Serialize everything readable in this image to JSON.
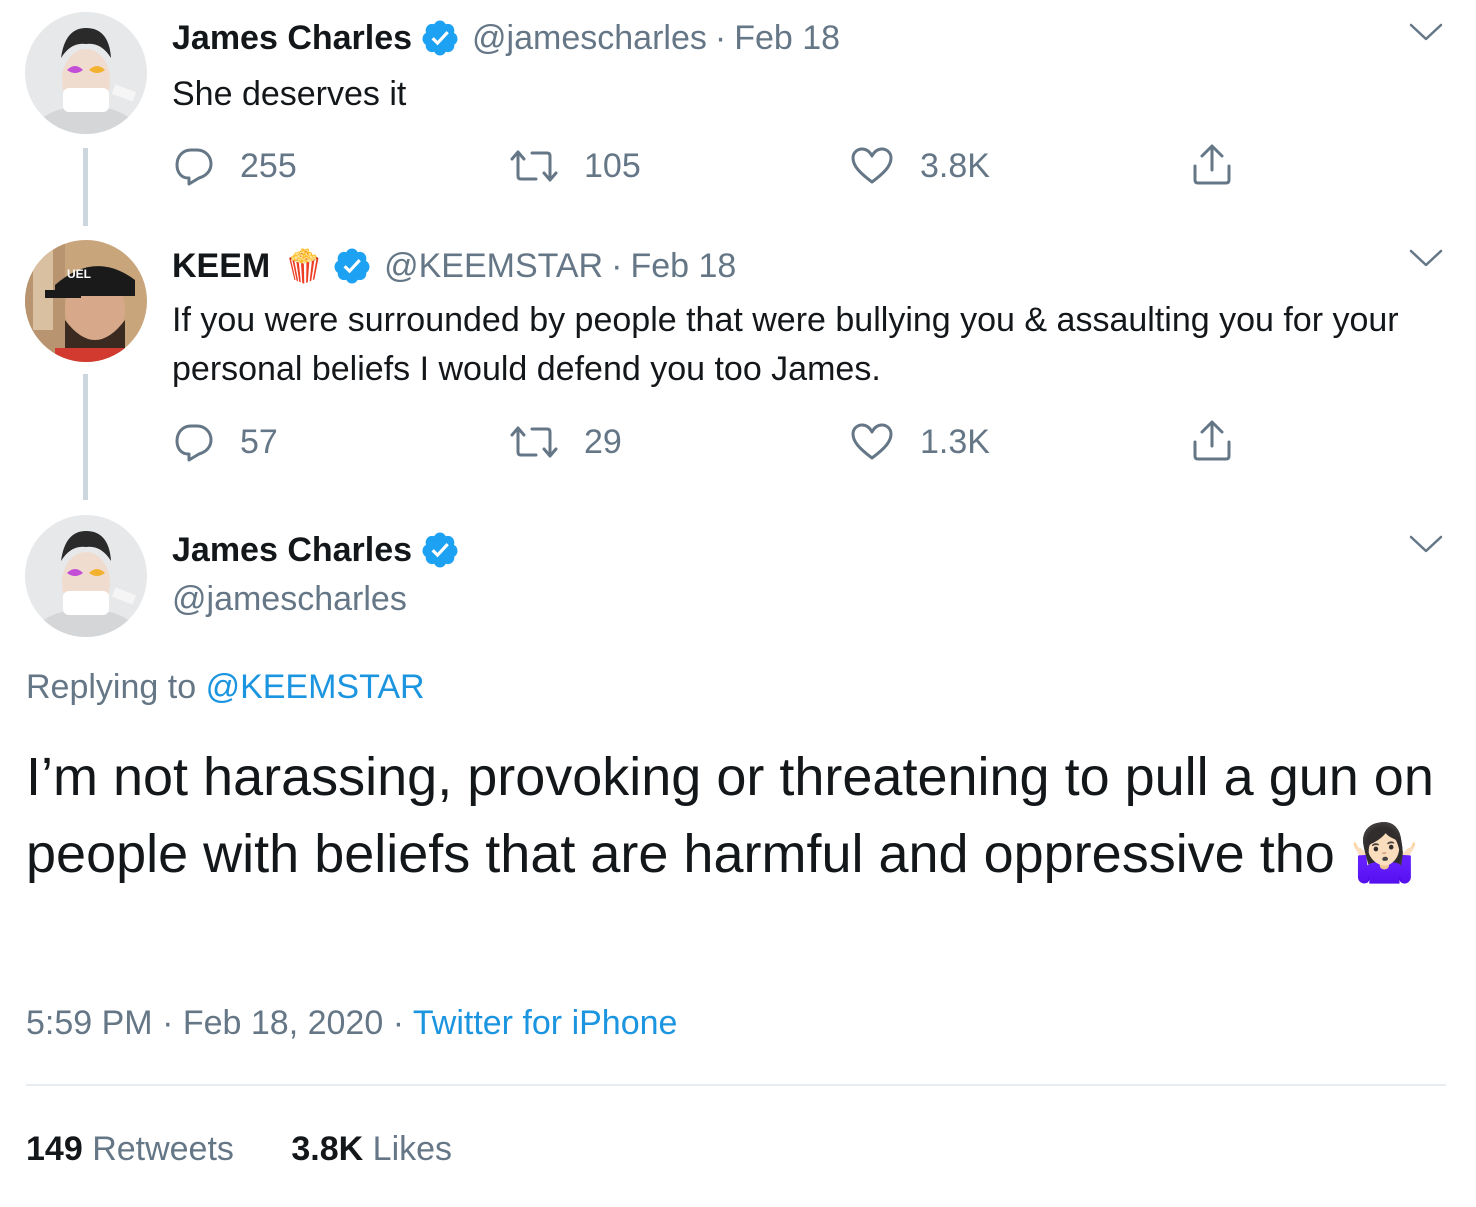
{
  "tweets": [
    {
      "name": "James Charles",
      "handle": "@jamescharles",
      "sep": "·",
      "date": "Feb 18",
      "text": "She deserves it",
      "replies": "255",
      "retweets": "105",
      "likes": "3.8K"
    },
    {
      "name": "KEEM",
      "name_emoji": "🍿",
      "handle": "@KEEMSTAR",
      "sep": "·",
      "date": "Feb 18",
      "text": "If you were surrounded by people that were bullying you & assaulting you for your personal beliefs I would defend you too James.",
      "replies": "57",
      "retweets": "29",
      "likes": "1.3K"
    }
  ],
  "main_tweet": {
    "name": "James Charles",
    "handle": "@jamescharles",
    "replying_prefix": "Replying to",
    "replying_handle": "@KEEMSTAR",
    "text": "I’m not harassing, provoking or threatening to pull a gun on people with beliefs that are harmful and oppressive tho",
    "emoji": "🤷🏻‍♀️",
    "time": "5:59 PM",
    "sep1": "·",
    "date": "Feb 18, 2020",
    "sep2": "·",
    "source": "Twitter for iPhone",
    "retweets_count": "149",
    "retweets_label": "Retweets",
    "likes_count": "3.8K",
    "likes_label": "Likes"
  },
  "icons": {
    "verified": "verified-badge-icon",
    "chevron": "chevron-down-icon",
    "reply": "reply-icon",
    "retweet": "retweet-icon",
    "like": "heart-icon",
    "share": "share-icon"
  },
  "colors": {
    "text": "#14171a",
    "secondary": "#657786",
    "link": "#1b95e0",
    "verified": "#1da1f2",
    "thread_line": "#ccd6dd"
  }
}
